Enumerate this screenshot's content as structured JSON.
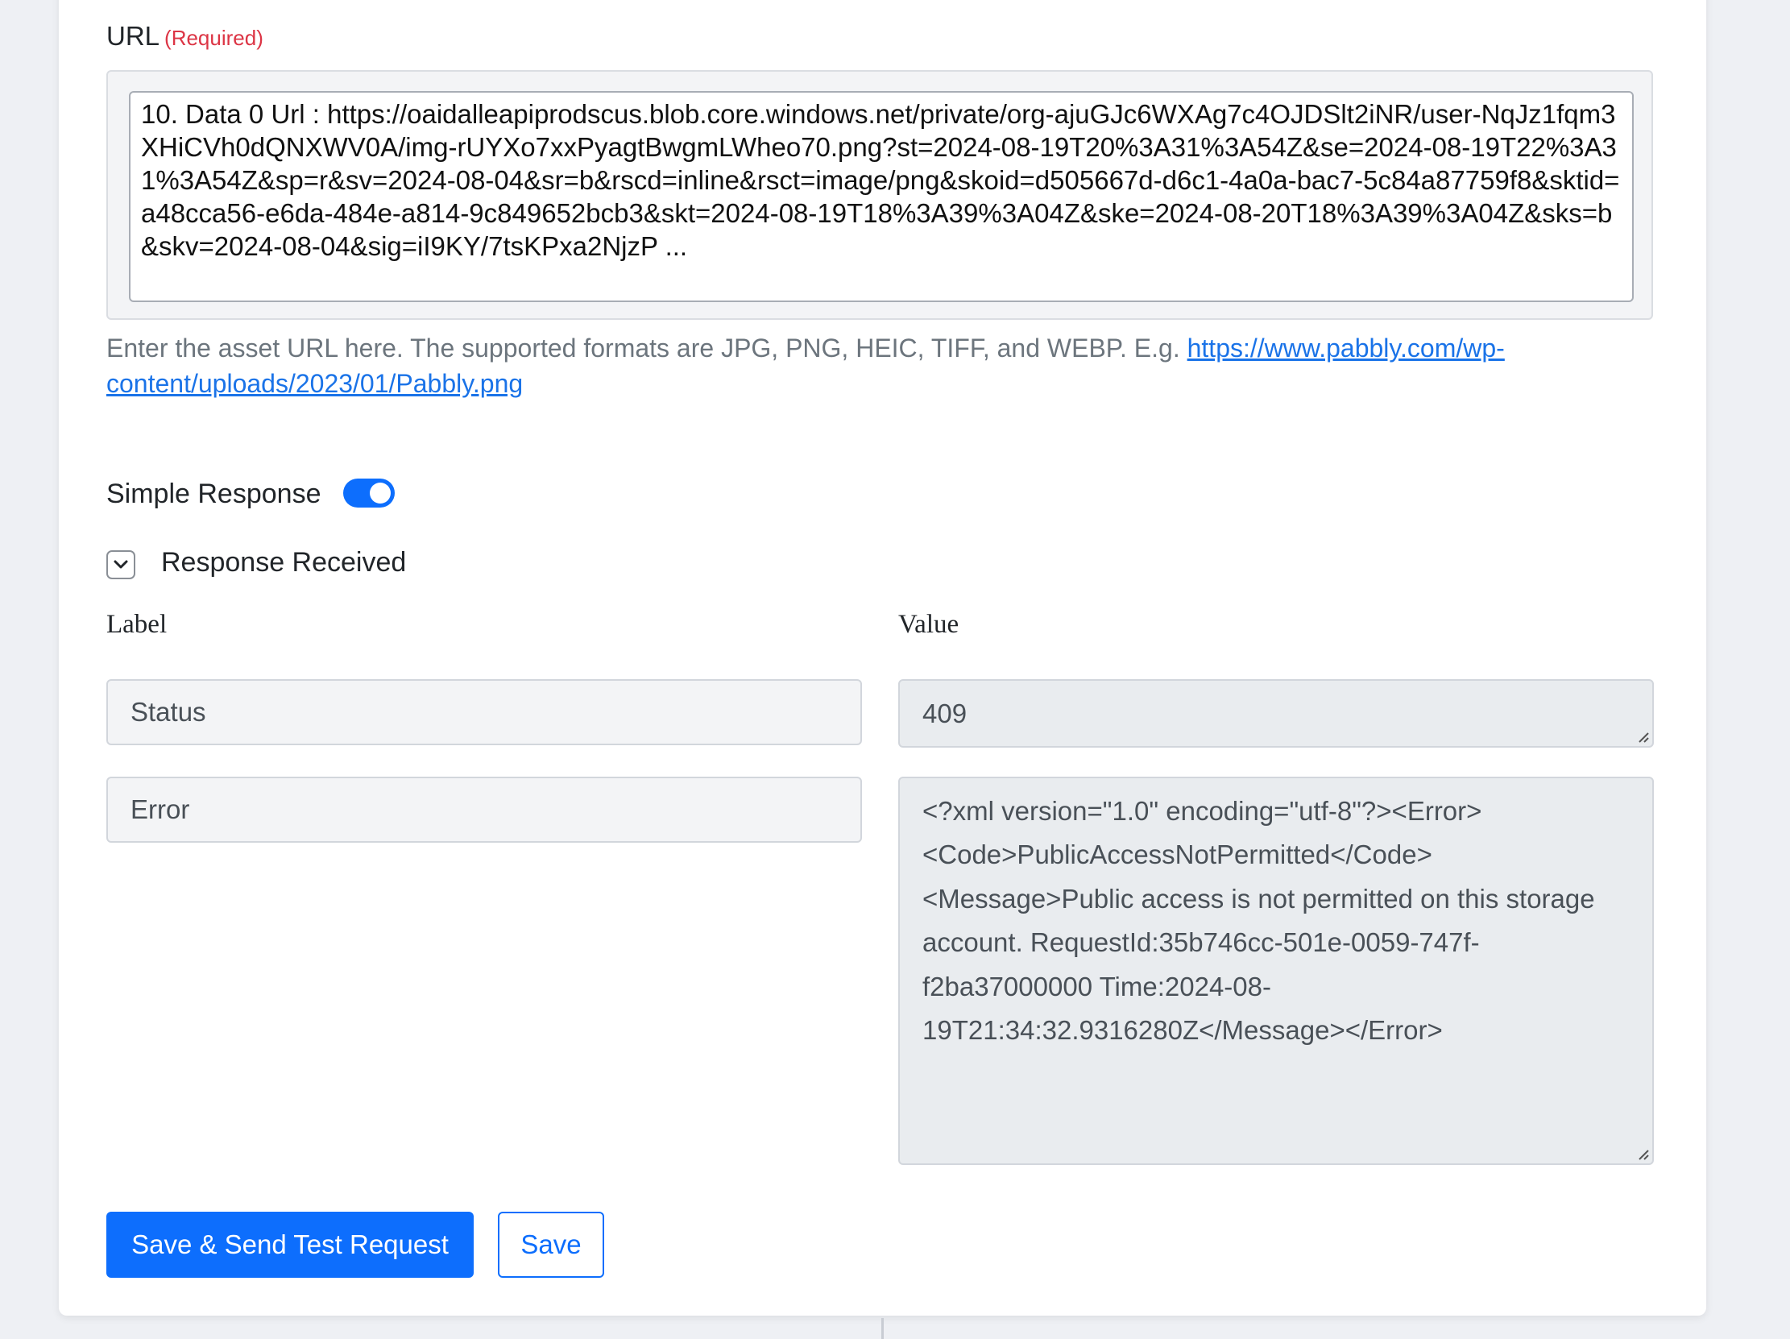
{
  "url_field": {
    "label": "URL",
    "required_tag": "(Required)",
    "value": "10. Data 0 Url : https://oaidalleapiprodscus.blob.core.windows.net/private/org-ajuGJc6WXAg7c4OJDSlt2iNR/user-NqJz1fqm3XHiCVh0dQNXWV0A/img-rUYXo7xxPyagtBwgmLWheo70.png?st=2024-08-19T20%3A31%3A54Z&se=2024-08-19T22%3A31%3A54Z&sp=r&sv=2024-08-04&sr=b&rscd=inline&rsct=image/png&skoid=d505667d-d6c1-4a0a-bac7-5c84a87759f8&sktid=a48cca56-e6da-484e-a814-9c849652bcb3&skt=2024-08-19T18%3A39%3A04Z&ske=2024-08-20T18%3A39%3A04Z&sks=b&skv=2024-08-04&sig=iI9KY/7tsKPxa2NjzP ...",
    "help_text": "Enter the asset URL here. The supported formats are JPG, PNG, HEIC, TIFF, and WEBP. E.g.",
    "help_link": "https://www.pabbly.com/wp-content/uploads/2023/01/Pabbly.png"
  },
  "simple_response": {
    "label": "Simple Response",
    "enabled": true
  },
  "response": {
    "toggle_label": "Response Received",
    "label_header": "Label",
    "value_header": "Value",
    "rows": [
      {
        "label": "Status",
        "value": "409"
      },
      {
        "label": "Error",
        "value": "<?xml version=\"1.0\" encoding=\"utf-8\"?><Error><Code>PublicAccessNotPermitted</Code><Message>Public access is not permitted on this storage account. RequestId:35b746cc-501e-0059-747f-f2ba37000000 Time:2024-08-19T21:34:32.9316280Z</Message></Error>"
      }
    ]
  },
  "buttons": {
    "primary": "Save & Send Test Request",
    "secondary": "Save"
  },
  "colors": {
    "primary": "#0d6efd",
    "required": "#dc3545",
    "link": "#1a73e8"
  },
  "icons": {
    "collapse": "chevron-down-icon",
    "resize": "resize-grip-icon"
  }
}
